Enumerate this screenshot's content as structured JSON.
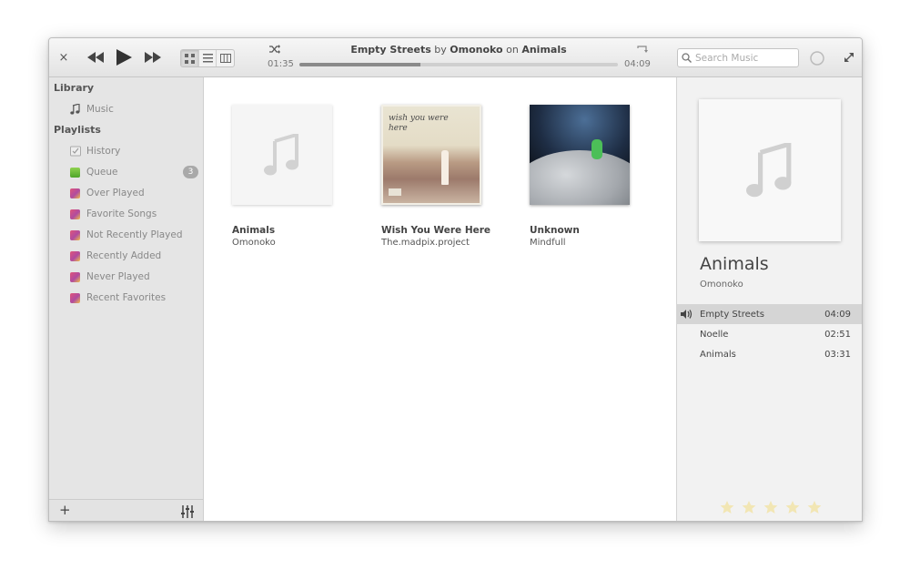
{
  "header": {
    "close_glyph": "×",
    "now_playing": {
      "track": "Empty Streets",
      "by": "by",
      "artist": "Omonoko",
      "on": "on",
      "album": "Animals"
    },
    "time_elapsed": "01:35",
    "time_total": "04:09",
    "progress_fraction": 0.38,
    "search_placeholder": "Search Music"
  },
  "sidebar": {
    "library_header": "Library",
    "library_items": [
      {
        "label": "Music",
        "icon": "music-note-icon"
      }
    ],
    "playlists_header": "Playlists",
    "playlists": [
      {
        "label": "History",
        "icon": "history-icon"
      },
      {
        "label": "Queue",
        "icon": "queue-icon",
        "badge": "3"
      },
      {
        "label": "Over Played",
        "icon": "playlist-icon"
      },
      {
        "label": "Favorite Songs",
        "icon": "playlist-icon"
      },
      {
        "label": "Not Recently Played",
        "icon": "playlist-icon"
      },
      {
        "label": "Recently Added",
        "icon": "playlist-icon"
      },
      {
        "label": "Never Played",
        "icon": "playlist-icon"
      },
      {
        "label": "Recent Favorites",
        "icon": "playlist-icon"
      }
    ],
    "add_glyph": "+"
  },
  "albums": [
    {
      "title": "Animals",
      "artist": "Omonoko",
      "cover": "placeholder"
    },
    {
      "title": "Wish You Were Here",
      "artist": "The.madpix.project",
      "cover": "art-desert",
      "cover_text": "wish you were here"
    },
    {
      "title": "Unknown",
      "artist": "Mindfull",
      "cover": "art-moon"
    }
  ],
  "details": {
    "title": "Animals",
    "artist": "Omonoko",
    "tracks": [
      {
        "name": "Empty Streets",
        "duration": "04:09",
        "playing": true
      },
      {
        "name": "Noelle",
        "duration": "02:51",
        "playing": false
      },
      {
        "name": "Animals",
        "duration": "03:31",
        "playing": false
      }
    ],
    "rating": 0,
    "rating_max": 5
  },
  "colors": {
    "sidebar_bg": "#e5e5e5",
    "playing_row": "#d5d5d5",
    "star": "#f2e6b4"
  }
}
